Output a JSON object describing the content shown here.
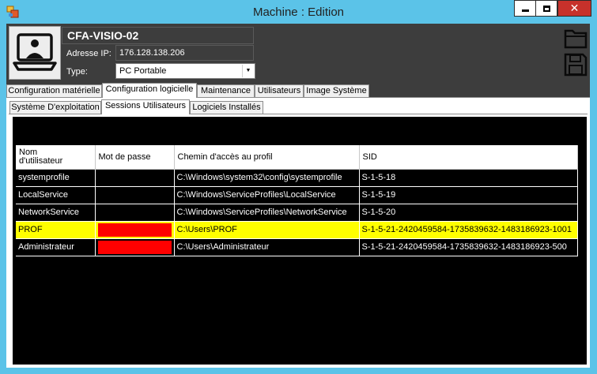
{
  "window": {
    "title": "Machine : Edition",
    "minimize_icon": "minimize-icon",
    "maximize_icon": "maximize-icon",
    "close_glyph": "✕"
  },
  "machine": {
    "name": "CFA-VISIO-02",
    "ip_label": "Adresse IP:",
    "ip_value": "176.128.138.206",
    "type_label": "Type:",
    "type_value": "PC Portable",
    "avatar_icon": "laptop-user-icon"
  },
  "actions": {
    "open_icon": "folder-icon",
    "save_icon": "floppy-disk-icon"
  },
  "main_tabs": [
    {
      "label": "Configuration matérielle"
    },
    {
      "label": "Configuration logicielle"
    },
    {
      "label": "Maintenance"
    },
    {
      "label": "Utilisateurs"
    },
    {
      "label": "Image Système"
    }
  ],
  "main_tab_selected": "Configuration logicielle",
  "sub_tabs": [
    {
      "label": "Système D'exploitation"
    },
    {
      "label": "Sessions Utilisateurs"
    },
    {
      "label": "Logiciels Installés"
    }
  ],
  "sub_tab_selected": "Sessions Utilisateurs",
  "grid": {
    "columns": [
      "Nom\nd'utilisateur",
      "Mot de passe",
      "Chemin d'accès au profil",
      "SID"
    ],
    "rows": [
      {
        "user": "systemprofile",
        "password": "",
        "path": "C:\\Windows\\system32\\config\\systemprofile",
        "sid": "S-1-5-18",
        "highlight": false
      },
      {
        "user": "LocalService",
        "password": "",
        "path": "C:\\Windows\\ServiceProfiles\\LocalService",
        "sid": "S-1-5-19",
        "highlight": false
      },
      {
        "user": "NetworkService",
        "password": "",
        "path": "C:\\Windows\\ServiceProfiles\\NetworkService",
        "sid": "S-1-5-20",
        "highlight": false
      },
      {
        "user": "PROF",
        "password": "",
        "path": "C:\\Users\\PROF",
        "sid": "S-1-5-21-2420459584-1735839632-1483186923-1001",
        "highlight": true
      },
      {
        "user": "Administrateur",
        "password": "",
        "path": "C:\\Users\\Administrateur",
        "sid": "S-1-5-21-2420459584-1735839632-1483186923-500",
        "highlight": false
      }
    ]
  },
  "colors": {
    "titlebar": "#5bc3e8",
    "window_bg": "#3d3d3d",
    "grid_bg": "#000000",
    "highlight_row": "#ffff00",
    "password_fill": "#ff0000",
    "close_button": "#c7312b"
  }
}
